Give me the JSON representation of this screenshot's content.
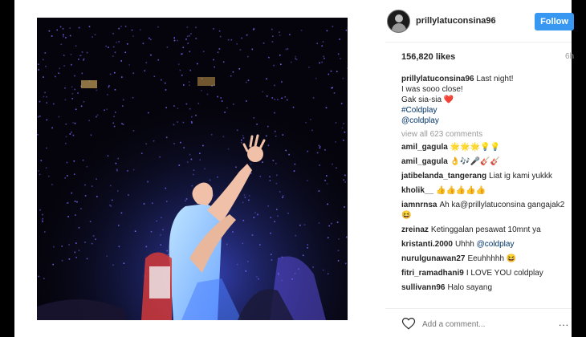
{
  "post": {
    "username": "prillylatuconsina96",
    "follow_label": "Follow",
    "likes": "156,820 likes",
    "time": "6h",
    "caption_user": "prillylatuconsina96",
    "caption_line1": "Last night!",
    "caption_line2": "I was sooo close!",
    "caption_line3": "Gak sia-sia",
    "heart": "❤️",
    "hashtag1": "#Coldplay",
    "hashtag2": "@coldplay",
    "view_all": "view all 623 comments",
    "add_comment_placeholder": "Add a comment...",
    "more": "..."
  },
  "comments": [
    {
      "user": "amil_gagula",
      "text": "🌟🌟🌟💡💡"
    },
    {
      "user": "amil_gagula",
      "text": "👌🎶🎤🎸🎸"
    },
    {
      "user": "jatibelanda_tangerang",
      "text": "Liat ig kami yukkk"
    },
    {
      "user": "kholik__",
      "text": "👍👍👍👍👍"
    },
    {
      "user": "iamnrnsa",
      "text": "Ah ka@prillylatuconsina gangajak2😆"
    },
    {
      "user": "zreinaz",
      "text": "Ketinggalan pesawat 10mnt ya"
    },
    {
      "user": "kristanti.2000",
      "text": "Uhhh",
      "link": "@coldplay"
    },
    {
      "user": "nurulgunawan27",
      "text": "Eeuhhhhh 😆"
    },
    {
      "user": "fitri_ramadhani9",
      "text": "I LOVE YOU coldplay"
    },
    {
      "user": "sullivann96",
      "text": "Halo sayang"
    }
  ],
  "colors": {
    "follow": "#3897f0",
    "link": "#003569",
    "muted": "#999999",
    "photo_bg": "#05040c",
    "crowd_lights": "#7b6cff"
  }
}
